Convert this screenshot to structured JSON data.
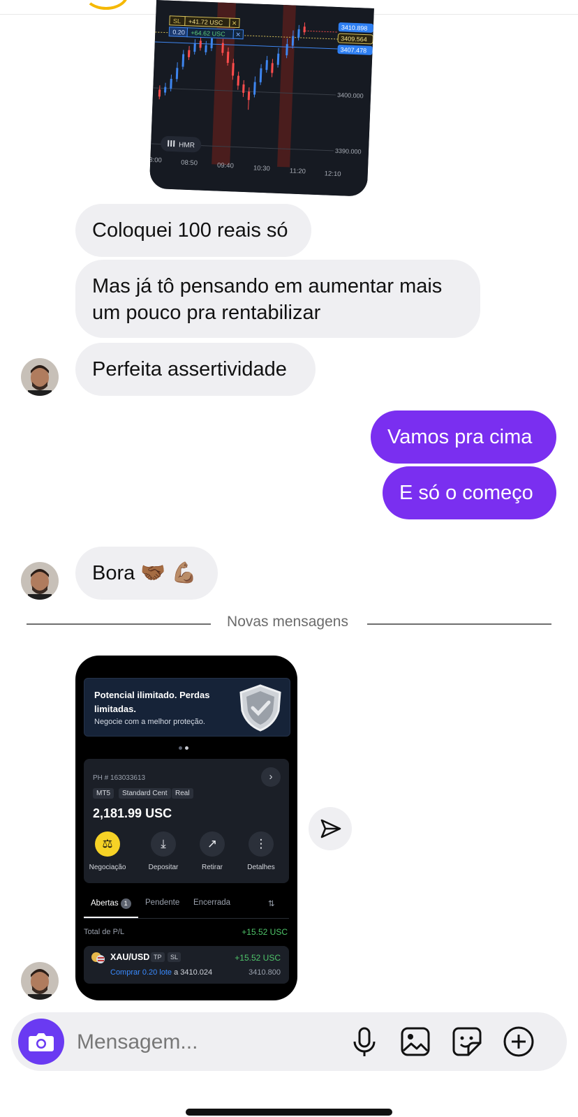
{
  "chart_shot": {
    "sl_tag": "SL",
    "sl_profit": "+41.72 USC",
    "lot": "0.20",
    "lot_profit": "+64.62 USC",
    "close": "✕",
    "price_current": "3410.898",
    "price_sl": "3409.564",
    "price_entry": "3407.478",
    "price_level_1": "3400.000",
    "price_level_2": "3390.000",
    "indicator_button": "HMR",
    "times": [
      "8:00",
      "08:50",
      "09:40",
      "10:30",
      "11:20",
      "12:10"
    ]
  },
  "messages": [
    {
      "side": "them",
      "text": "Coloquei 100 reais só"
    },
    {
      "side": "them",
      "text": "Mas já tô pensando em aumentar mais um pouco pra rentabilizar"
    },
    {
      "side": "them",
      "text": "Perfeita assertividade"
    },
    {
      "side": "me",
      "text": "Vamos pra cima"
    },
    {
      "side": "me",
      "text": "E só o começo"
    },
    {
      "side": "them",
      "text": "Bora 🤝🏾 💪🏽"
    }
  ],
  "divider": "Novas mensagens",
  "phone_shot": {
    "banner_title": "Potencial ilimitado. Perdas limitadas.",
    "banner_sub": "Negocie com a melhor proteção.",
    "account_id": "PH # 163033613",
    "tags": [
      "MT5",
      "Standard Cent",
      "Real"
    ],
    "balance": "2,181.99 USC",
    "actions": [
      "Negociação",
      "Depositar",
      "Retirar",
      "Detalhes"
    ],
    "tabs": [
      "Abertas",
      "Pendente",
      "Encerrada"
    ],
    "open_count": "1",
    "pl_label": "Total de P/L",
    "pl_value": "+15.52 USC",
    "position": {
      "symbol": "XAU/USD",
      "tags": [
        "TP",
        "SL"
      ],
      "profit": "+15.52 USC",
      "action": "Comprar 0.20 lote",
      "at": "a 3410.024",
      "price": "3410.800"
    }
  },
  "composer": {
    "placeholder": "Mensagem..."
  },
  "colors": {
    "my_bubble": "#7a2ff0",
    "their_bubble": "#efeff2",
    "camera_button": "#6a3af2",
    "profit_green": "#4fc56a"
  }
}
